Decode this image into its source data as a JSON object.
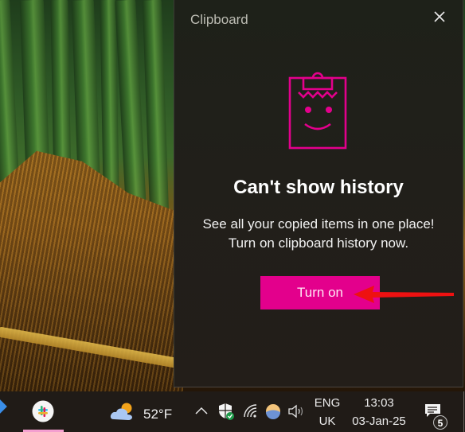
{
  "clipboard_panel": {
    "title": "Clipboard",
    "close_icon": "close-icon",
    "illustration_icon": "smiling-clipboard-icon",
    "heading": "Can't show history",
    "description_line1": "See all your copied items in one place!",
    "description_line2": "Turn on clipboard history now.",
    "turn_on_label": "Turn on",
    "annotation": "red-arrow-pointing-to-turn-on"
  },
  "taskbar": {
    "pinned_apps": [
      {
        "name": "slack",
        "icon": "slack-icon",
        "active": true
      }
    ],
    "weather": {
      "icon": "partly-cloudy-icon",
      "temperature": "52°F"
    },
    "tray_icons": [
      "chevron-up-icon",
      "windows-security-icon",
      "wifi-icon",
      "app-tray-icon",
      "volume-icon"
    ],
    "language": {
      "line1": "ENG",
      "line2": "UK"
    },
    "clock": {
      "time": "13:03",
      "date": "03-Jan-25"
    },
    "notifications": {
      "icon": "notification-center-icon",
      "count": "5"
    }
  },
  "colors": {
    "accent": "#e3008c",
    "panel_bg": "#211f1a",
    "taskbar_bg": "#201b17",
    "annotation_arrow": "#ee1111"
  }
}
